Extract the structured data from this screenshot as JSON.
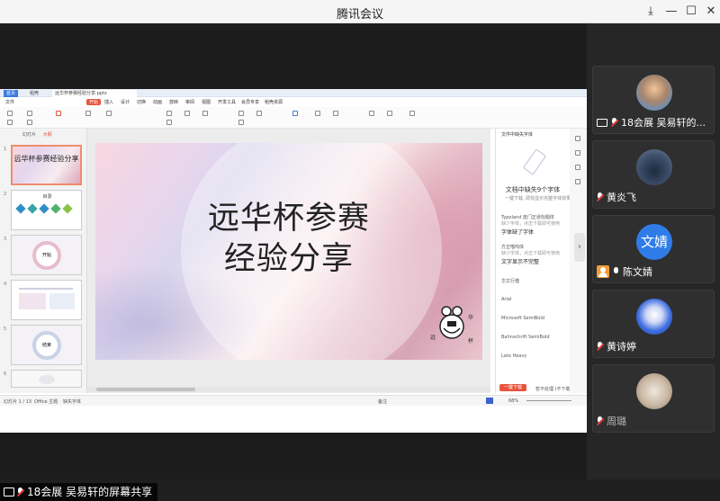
{
  "window": {
    "title": "腾讯会议",
    "controls": {
      "pin": "⤓",
      "minimize": "—",
      "maximize": "☐",
      "close": "✕"
    }
  },
  "wps": {
    "tabs": [
      "首页",
      "稻壳",
      "远华杯参赛经验分享.pptx"
    ],
    "menu": [
      "文件",
      "开始",
      "插入",
      "设计",
      "切换",
      "动画",
      "放映",
      "审阅",
      "视图",
      "开发工具",
      "会员专享",
      "稻壳资源"
    ],
    "active_menu_index": 1,
    "panel_tabs": [
      "幻灯片",
      "大纲"
    ],
    "slides": [
      {
        "num": "1",
        "caption": "远华杯参赛经验分享"
      },
      {
        "num": "2",
        "caption": "目录"
      },
      {
        "num": "3",
        "caption": "开始"
      },
      {
        "num": "4",
        "caption": ""
      },
      {
        "num": "5",
        "caption": "结束"
      },
      {
        "num": "6",
        "caption": ""
      }
    ],
    "current_slide_title_line1": "远华杯参赛",
    "current_slide_title_line2": "经验分享",
    "stamp_text": "远华杯",
    "right_panel": {
      "header": "文件中缺失字体",
      "title": "文档中缺失9个字体",
      "subtitle": "一键下载, 即刻显示完整字体效果",
      "fonts": [
        {
          "name": "Typoland 庞门正道标题体",
          "note": "缺少字体，点击下载即可使用",
          "preview": "字体缺了字体"
        },
        {
          "name": "方正喵呜体",
          "note": "缺少字体，点击下载即可使用",
          "preview": "文字显示不完整"
        },
        {
          "name": "华文行楷",
          "note": ""
        },
        {
          "name": "Arial",
          "note": ""
        },
        {
          "name": "Microsoft SemiBold",
          "note": ""
        },
        {
          "name": "Bahnschrift SemiBold",
          "note": ""
        },
        {
          "name": "Lato Heavy",
          "note": ""
        }
      ],
      "download_button": "一键下载",
      "later_link": "暂不处理 (不下载)"
    },
    "status": {
      "slide_pos": "幻灯片 1 / 13",
      "theme": "Office 主题",
      "font_missing": "缺失字体",
      "notes": "备注",
      "zoom": "68%"
    }
  },
  "share_label": "18会展 吴易轩的屏幕共享",
  "participants": [
    {
      "name": "18会展 吴易轩的...",
      "avatar_type": "photo",
      "avatar_color": "#8fa6c2",
      "icon": "screen-share",
      "mic": "muted"
    },
    {
      "name": "黄炎飞",
      "avatar_type": "photo",
      "avatar_color": "#3e4f6b",
      "icon": "none",
      "mic": "muted"
    },
    {
      "name": "陈文婧",
      "avatar_type": "text",
      "avatar_text": "文婧",
      "avatar_color": "#2f7ce8",
      "icon": "user",
      "mic": "on"
    },
    {
      "name": "黄诗婷",
      "avatar_type": "photo",
      "avatar_color": "#3f6ee0",
      "icon": "none",
      "mic": "muted"
    },
    {
      "name": "周璐",
      "avatar_type": "photo",
      "avatar_color": "#c9b7a3",
      "icon": "none",
      "mic": "muted"
    }
  ]
}
